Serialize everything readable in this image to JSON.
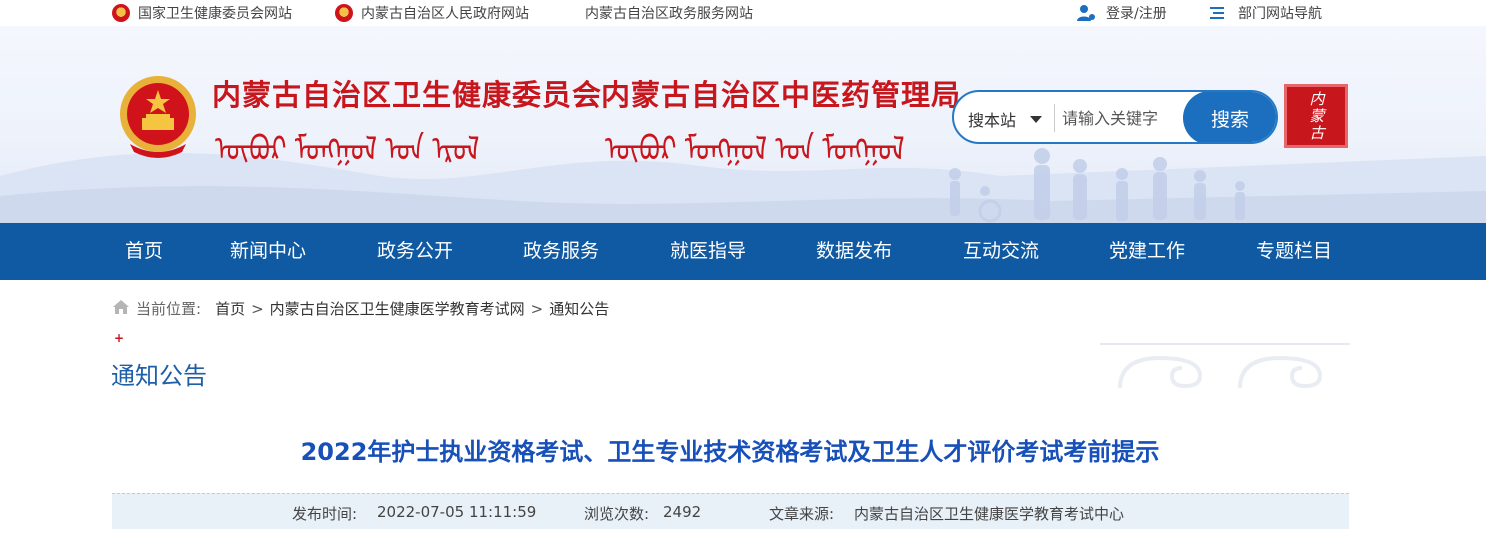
{
  "topbar": {
    "links": [
      "国家卫生健康委员会网站",
      "内蒙古自治区人民政府网站",
      "内蒙古自治区政务服务网站"
    ],
    "login": "登录/注册",
    "dept_nav": "部门网站导航"
  },
  "header": {
    "org1": "内蒙古自治区卫生健康委员会",
    "org2": "内蒙古自治区中医药管理局",
    "mongol1": "ᠦᠪᠦᠷ ᠮᠣᠩᠭᠣᠯ ᠤᠨ ᠡᠷᠦᠯ",
    "mongol2": "ᠦᠪᠦᠷ ᠮᠣᠩᠭᠣᠯ ᠤᠨ ᠮᠣᠩᠭᠣᠯ",
    "stamp_text": "内蒙古"
  },
  "search": {
    "scope": "搜本站",
    "placeholder": "请输入关键字",
    "button": "搜索"
  },
  "nav": [
    "首页",
    "新闻中心",
    "政务公开",
    "政务服务",
    "就医指导",
    "数据发布",
    "互动交流",
    "党建工作",
    "专题栏目"
  ],
  "breadcrumb": {
    "label": "当前位置:",
    "items": [
      "首页",
      "内蒙古自治区卫生健康医学教育考试网",
      "通知公告"
    ],
    "separator": ">"
  },
  "section": {
    "title": "通知公告"
  },
  "article": {
    "title": "2022年护士执业资格考试、卫生专业技术资格考试及卫生人才评价考试考前提示",
    "publish_label": "发布时间:",
    "publish_time": "2022-07-05 11:11:59",
    "views_label": "浏览次数:",
    "views": "2492",
    "source_label": "文章来源:",
    "source": "内蒙古自治区卫生健康医学教育考试中心"
  },
  "colors": {
    "nav_bg": "#0f5aa3",
    "brand_red": "#c8161d",
    "search_blue": "#1c6fbf"
  }
}
